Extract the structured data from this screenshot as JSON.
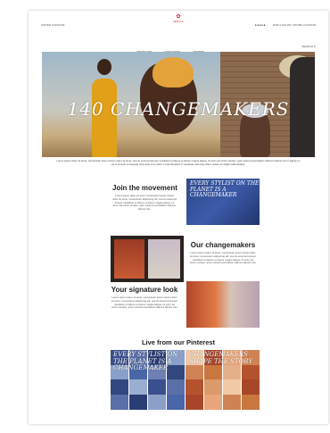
{
  "header": {
    "location_label": "UNITED KINGDOM",
    "brand_name": "WELLA",
    "nav_items": [
      "PRODUCTS",
      "EDUCATION",
      "TRENDS",
      "—"
    ],
    "util_links": "FIND A SALON  |  STORE LOCATOR",
    "social_icons": [
      "instagram-icon",
      "facebook-icon",
      "youtube-icon",
      "pinterest-icon",
      "twitter-icon"
    ],
    "search_label": "SEARCH",
    "search_icon": "search-icon"
  },
  "hero": {
    "title": "140 CHANGEMAKERS"
  },
  "intro": {
    "text": "Lorem ipsum dolor sit amet, consectetur ipsum ipsum dolor sit amet, sed do eiusmod tempor incididunt ut labore et dolore magna aliqua. Ut enim ad minim veniam, quis nostrud exercitation ullamco laboris nisi ut aliquip ex ea commodo consequat. Duis aute irure dolor in reprehenderit in voluptate velit esse cillum dolore eu fugiat nulla pariatur."
  },
  "sections": {
    "join": {
      "title": "Join the movement",
      "body": "Lorem ipsum dolor sit amet, consectetur ipsum ipsum dolor sit amet, consectetur adipiscing elit, sed do eiusmod tempor incididunt ut labore et dolore magna aliqua. Ut enim ad minim veniam, quis nostrud exercitation ullamco laboris nisi."
    },
    "join_card": {
      "text": "EVERY STYLIST ON THE PLANET IS A CHANGEMAKER"
    },
    "changemakers": {
      "title": "Our changemakers",
      "body": "Lorem ipsum dolor sit amet, consectetur ipsum ipsum dolor sit amet, consectetur adipiscing elit, sed do eiusmod tempor incididunt ut labore et dolore magna aliqua. Ut enim ad minim veniam, quis nostrud exercitation ullamco laboris nisi."
    },
    "signature": {
      "title": "Your signature look",
      "body": "Lorem ipsum dolor sit amet, consectetur ipsum ipsum dolor sit amet, consectetur adipiscing elit, sed do eiusmod tempor incididunt ut labore et dolore magna aliqua. Ut enim ad minim veniam, quis nostrud exercitation ullamco laboris nisi."
    }
  },
  "pinterest": {
    "title": "Live from our Pinterest",
    "overlay_left": "EVERY STYLIST ON THE PLANET IS A CHANGEMAKER",
    "overlay_right": "CHANGEMAKERS SHAPE THE STORY"
  },
  "colors": {
    "brand_red": "#c8102e",
    "card_blue": "#2f4a8c"
  }
}
